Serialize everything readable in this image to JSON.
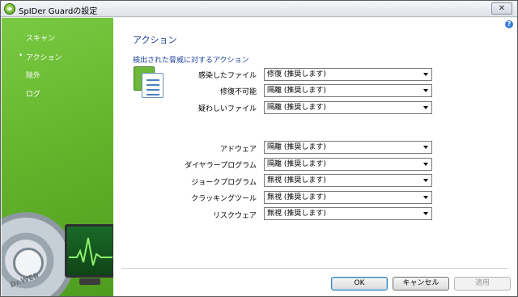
{
  "window": {
    "title": "SpIDer Guardの設定",
    "close_label": "✕"
  },
  "sidebar": {
    "items": [
      {
        "label": "スキャン",
        "selected": false
      },
      {
        "label": "アクション",
        "selected": true
      },
      {
        "label": "除外",
        "selected": false
      },
      {
        "label": "ログ",
        "selected": false
      }
    ],
    "bullet": "•",
    "logo_text": "Dr.WEB"
  },
  "content": {
    "help_label": "?",
    "heading": "アクション",
    "subheading": "検出された脅威に対するアクション",
    "group1": [
      {
        "label": "感染したファイル",
        "value": "修復 (推奨します)"
      },
      {
        "label": "修復不可能",
        "value": "隔離 (推奨します)"
      },
      {
        "label": "疑わしいファイル",
        "value": "隔離 (推奨します)"
      }
    ],
    "group2": [
      {
        "label": "アドウェア",
        "value": "隔離 (推奨します)"
      },
      {
        "label": "ダイヤラープログラム",
        "value": "隔離 (推奨します)"
      },
      {
        "label": "ジョークプログラム",
        "value": "無視 (推奨します)"
      },
      {
        "label": "クラッキングツール",
        "value": "無視 (推奨します)"
      },
      {
        "label": "リスクウェア",
        "value": "無視 (推奨します)"
      }
    ]
  },
  "buttons": {
    "ok": "OK",
    "cancel": "キャンセル",
    "apply": "適用"
  },
  "colors": {
    "accent": "#1a3e9e",
    "sidebar_green": "#64b52c"
  },
  "icons": [
    "app-shield-icon",
    "close-icon",
    "help-icon",
    "action-document-icon",
    "dropdown-arrow-icon"
  ]
}
